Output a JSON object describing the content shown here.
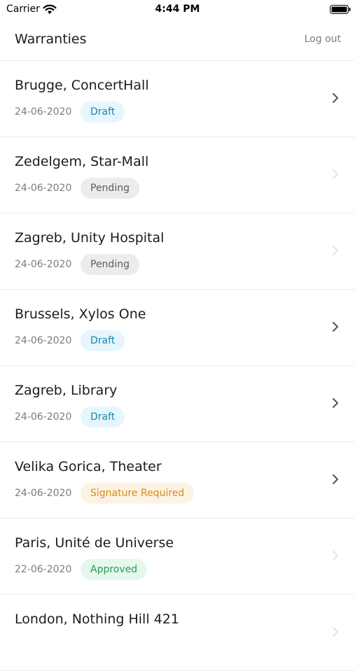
{
  "status_bar": {
    "carrier": "Carrier",
    "time": "4:44 PM"
  },
  "header": {
    "title": "Warranties",
    "logout_label": "Log out"
  },
  "status_colors": {
    "Draft": {
      "bg": "#e7f6fc",
      "fg": "#1687b0"
    },
    "Pending": {
      "bg": "#ececec",
      "fg": "#5c5c5c"
    },
    "Signature Required": {
      "bg": "#fdf3e5",
      "fg": "#d98a1a"
    },
    "Approved": {
      "bg": "#e6f7ec",
      "fg": "#2c9a55"
    }
  },
  "warranties": [
    {
      "title": "Brugge, ConcertHall",
      "date": "24-06-2020",
      "status": "Draft",
      "chevron": "dark"
    },
    {
      "title": "Zedelgem, Star-Mall",
      "date": "24-06-2020",
      "status": "Pending",
      "chevron": "light"
    },
    {
      "title": "Zagreb, Unity Hospital",
      "date": "24-06-2020",
      "status": "Pending",
      "chevron": "light"
    },
    {
      "title": "Brussels, Xylos One",
      "date": "24-06-2020",
      "status": "Draft",
      "chevron": "dark"
    },
    {
      "title": "Zagreb, Library",
      "date": "24-06-2020",
      "status": "Draft",
      "chevron": "dark"
    },
    {
      "title": "Velika Gorica, Theater",
      "date": "24-06-2020",
      "status": "Signature Required",
      "chevron": "dark"
    },
    {
      "title": "Paris, Unité de Universe",
      "date": "22-06-2020",
      "status": "Approved",
      "chevron": "light"
    },
    {
      "title": "London, Nothing Hill 421",
      "date": "",
      "status": "",
      "chevron": "light"
    }
  ]
}
